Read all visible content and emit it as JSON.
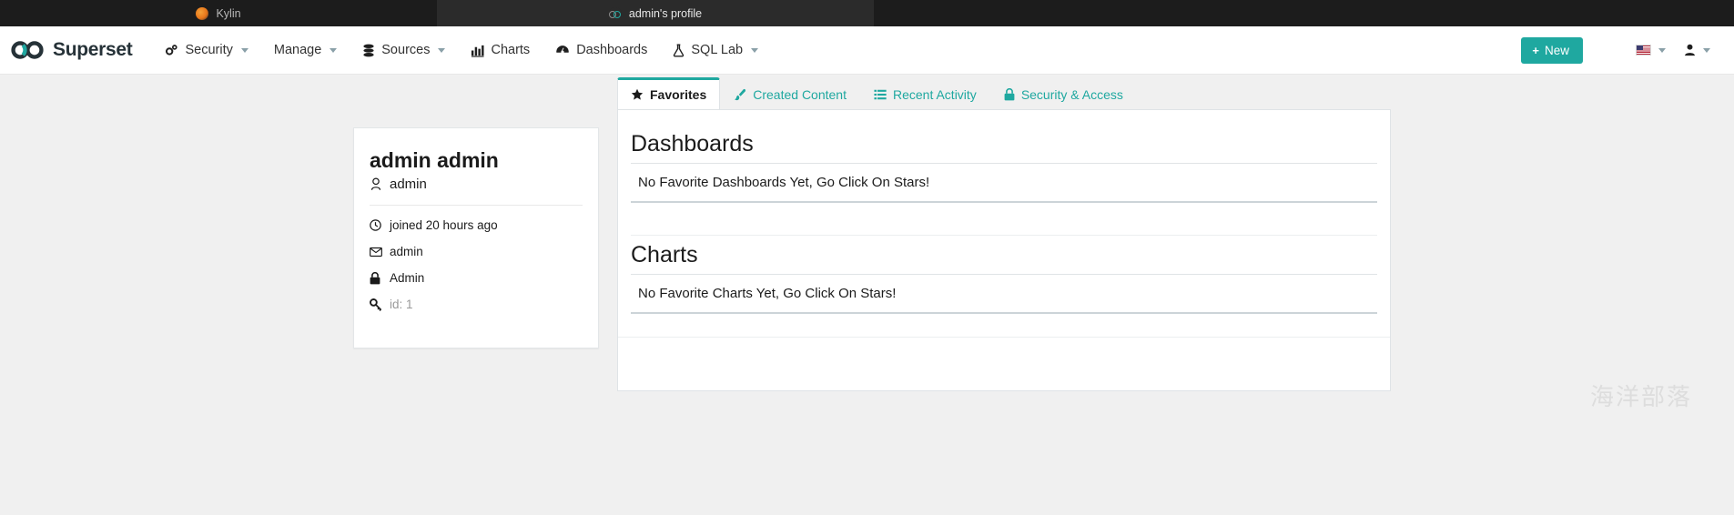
{
  "browser": {
    "tabs": [
      {
        "title": "Kylin",
        "favicon": "kylin-favicon",
        "active": false
      },
      {
        "title": "admin's profile",
        "favicon": "superset-favicon",
        "active": true
      }
    ]
  },
  "navbar": {
    "brand": "Superset",
    "brand_logo_icon": "superset-infinity-logo",
    "accent_color": "#1fa8a0",
    "items": [
      {
        "label": "Security",
        "icon": "gears-icon",
        "has_caret": true
      },
      {
        "label": "Manage",
        "icon": "",
        "has_caret": true
      },
      {
        "label": "Sources",
        "icon": "database-icon",
        "has_caret": true
      },
      {
        "label": "Charts",
        "icon": "bar-chart-icon",
        "has_caret": false
      },
      {
        "label": "Dashboards",
        "icon": "dashboard-icon",
        "has_caret": false
      },
      {
        "label": "SQL Lab",
        "icon": "flask-icon",
        "has_caret": true
      }
    ],
    "new_button": {
      "label": "New",
      "plus": "+"
    },
    "language_icon": "us-flag-icon",
    "user_icon": "person-icon"
  },
  "profile": {
    "full_name": "admin admin",
    "username": "admin",
    "username_icon": "user-outline-icon",
    "meta": [
      {
        "icon": "clock-icon",
        "text": "joined 20 hours ago",
        "muted": false
      },
      {
        "icon": "envelope-icon",
        "text": "admin",
        "muted": false
      },
      {
        "icon": "lock-icon",
        "text": "Admin",
        "muted": false
      },
      {
        "icon": "key-icon",
        "text": "id: 1",
        "muted": true
      }
    ]
  },
  "tabs": [
    {
      "label": "Favorites",
      "icon": "star-icon",
      "active": true
    },
    {
      "label": "Created Content",
      "icon": "paintbrush-icon",
      "active": false
    },
    {
      "label": "Recent Activity",
      "icon": "list-icon",
      "active": false
    },
    {
      "label": "Security & Access",
      "icon": "lock-icon",
      "active": false
    }
  ],
  "panel": {
    "sections": [
      {
        "title": "Dashboards",
        "empty_text": "No Favorite Dashboards Yet, Go Click On Stars!"
      },
      {
        "title": "Charts",
        "empty_text": "No Favorite Charts Yet, Go Click On Stars!"
      }
    ]
  },
  "watermark": "海洋部落"
}
